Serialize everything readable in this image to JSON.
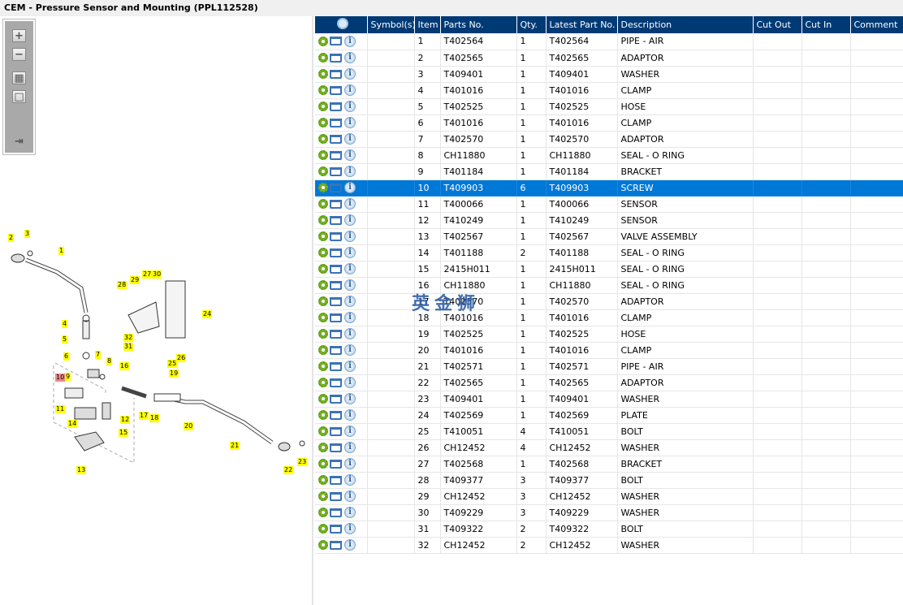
{
  "title": "CEM - Pressure Sensor and Mounting (PPL112528)",
  "toolbar": {
    "zoom_in": "+",
    "zoom_out": "−",
    "fit": "▦",
    "actual": "□",
    "export": "⇥"
  },
  "watermark": "英金狮",
  "diagram": {
    "callouts": [
      "1",
      "2",
      "3",
      "4",
      "5",
      "6",
      "7",
      "8",
      "9",
      "10",
      "11",
      "12",
      "13",
      "14",
      "15",
      "16",
      "17",
      "18",
      "19",
      "20",
      "21",
      "22",
      "23",
      "24",
      "25",
      "26",
      "27",
      "28",
      "29",
      "30",
      "31",
      "32"
    ],
    "highlighted": "10",
    "highlight_color": "#ee8888",
    "callout_color": "#ffff00"
  },
  "table": {
    "headers": [
      "",
      "Symbol(s)",
      "Item",
      "Parts No.",
      "Qty.",
      "Latest Part No.",
      "Description",
      "Cut Out",
      "Cut In",
      "Comment"
    ],
    "selected_item": "10",
    "accent": "#0078d7",
    "header_bg": "#003a75",
    "rows": [
      [
        "1",
        "T402564",
        "1",
        "T402564",
        "PIPE - AIR"
      ],
      [
        "2",
        "T402565",
        "1",
        "T402565",
        "ADAPTOR"
      ],
      [
        "3",
        "T409401",
        "1",
        "T409401",
        "WASHER"
      ],
      [
        "4",
        "T401016",
        "1",
        "T401016",
        "CLAMP"
      ],
      [
        "5",
        "T402525",
        "1",
        "T402525",
        "HOSE"
      ],
      [
        "6",
        "T401016",
        "1",
        "T401016",
        "CLAMP"
      ],
      [
        "7",
        "T402570",
        "1",
        "T402570",
        "ADAPTOR"
      ],
      [
        "8",
        "CH11880",
        "1",
        "CH11880",
        "SEAL - O RING"
      ],
      [
        "9",
        "T401184",
        "1",
        "T401184",
        "BRACKET"
      ],
      [
        "10",
        "T409903",
        "6",
        "T409903",
        "SCREW"
      ],
      [
        "11",
        "T400066",
        "1",
        "T400066",
        "SENSOR"
      ],
      [
        "12",
        "T410249",
        "1",
        "T410249",
        "SENSOR"
      ],
      [
        "13",
        "T402567",
        "1",
        "T402567",
        "VALVE ASSEMBLY"
      ],
      [
        "14",
        "T401188",
        "2",
        "T401188",
        "SEAL - O RING"
      ],
      [
        "15",
        "2415H011",
        "1",
        "2415H011",
        "SEAL - O RING"
      ],
      [
        "16",
        "CH11880",
        "1",
        "CH11880",
        "SEAL - O RING"
      ],
      [
        "17",
        "T402570",
        "1",
        "T402570",
        "ADAPTOR"
      ],
      [
        "18",
        "T401016",
        "1",
        "T401016",
        "CLAMP"
      ],
      [
        "19",
        "T402525",
        "1",
        "T402525",
        "HOSE"
      ],
      [
        "20",
        "T401016",
        "1",
        "T401016",
        "CLAMP"
      ],
      [
        "21",
        "T402571",
        "1",
        "T402571",
        "PIPE - AIR"
      ],
      [
        "22",
        "T402565",
        "1",
        "T402565",
        "ADAPTOR"
      ],
      [
        "23",
        "T409401",
        "1",
        "T409401",
        "WASHER"
      ],
      [
        "24",
        "T402569",
        "1",
        "T402569",
        "PLATE"
      ],
      [
        "25",
        "T410051",
        "4",
        "T410051",
        "BOLT"
      ],
      [
        "26",
        "CH12452",
        "4",
        "CH12452",
        "WASHER"
      ],
      [
        "27",
        "T402568",
        "1",
        "T402568",
        "BRACKET"
      ],
      [
        "28",
        "T409377",
        "3",
        "T409377",
        "BOLT"
      ],
      [
        "29",
        "CH12452",
        "3",
        "CH12452",
        "WASHER"
      ],
      [
        "30",
        "T409229",
        "3",
        "T409229",
        "WASHER"
      ],
      [
        "31",
        "T409322",
        "2",
        "T409322",
        "BOLT"
      ],
      [
        "32",
        "CH12452",
        "2",
        "CH12452",
        "WASHER"
      ]
    ]
  }
}
